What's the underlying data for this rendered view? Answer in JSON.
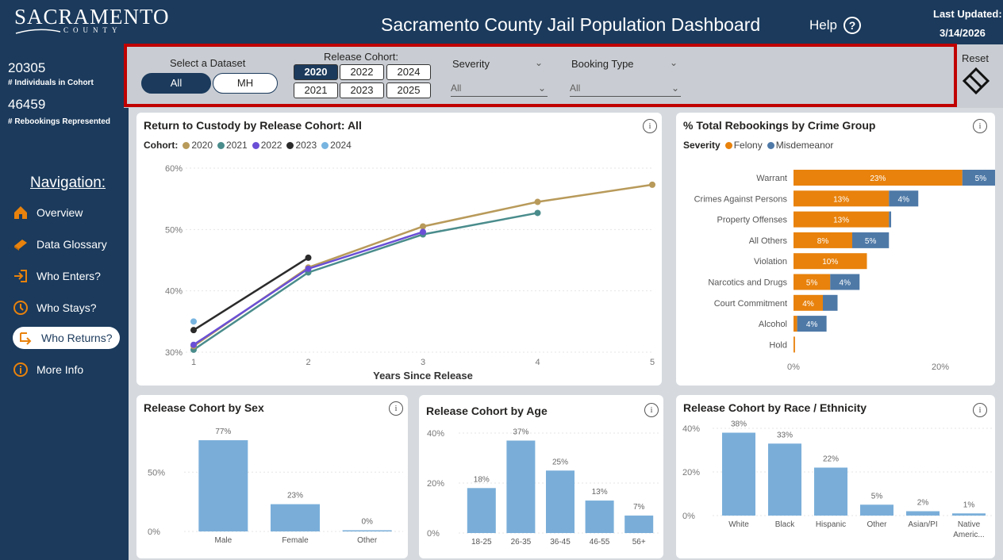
{
  "header": {
    "logo_text": "SACRAMENTO",
    "logo_sub": "COUNTY",
    "title": "Sacramento County Jail Population Dashboard",
    "help_label": "Help",
    "help_icon": "question-circle-icon",
    "updated_label": "Last Updated:",
    "updated_date": "3/14/2026"
  },
  "sidebar": {
    "individuals_value": "20305",
    "individuals_label": "# Individuals in Cohort",
    "rebookings_value": "46459",
    "rebookings_label": "# Rebookings Represented",
    "nav_title": "Navigation:",
    "items": [
      {
        "label": "Overview",
        "icon": "home-icon"
      },
      {
        "label": "Data Glossary",
        "icon": "book-icon"
      },
      {
        "label": "Who Enters?",
        "icon": "enter-icon"
      },
      {
        "label": "Who Stays?",
        "icon": "clock-icon"
      },
      {
        "label": "Who Returns?",
        "icon": "return-arrow-icon",
        "active": true
      },
      {
        "label": "More Info",
        "icon": "info-icon"
      }
    ]
  },
  "filters": {
    "dataset_label": "Select a Dataset",
    "dataset_options": [
      "All",
      "MH"
    ],
    "dataset_selected": "All",
    "cohort_label": "Release Cohort:",
    "cohort_options": [
      "2020",
      "2022",
      "2024",
      "2021",
      "2023",
      "2025"
    ],
    "cohort_selected": "2020",
    "severity_label": "Severity",
    "severity_value": "All",
    "booking_label": "Booking Type",
    "booking_value": "All",
    "reset_label": "Reset"
  },
  "colors": {
    "navy": "#1b3a5c",
    "felony": "#e8820c",
    "misdemeanor": "#4e79a7",
    "bar": "#7aaed9",
    "c2020": "#b89a5a",
    "c2021": "#4a8c8c",
    "c2022": "#6a4fd6",
    "c2023": "#2b2b2b",
    "c2024": "#78b4e0",
    "highlight": "#c00000"
  },
  "charts": {
    "rtc": {
      "title": "Return to Custody by Release Cohort: All",
      "legend_title": "Cohort:",
      "xlabel": "Years Since Release"
    },
    "crime": {
      "title": "% Total Rebookings by Crime Group",
      "legend_title": "Severity"
    },
    "sex": {
      "title": "Release Cohort by Sex"
    },
    "age": {
      "title": "Release Cohort by Age"
    },
    "race": {
      "title": "Release Cohort by Race / Ethnicity"
    }
  },
  "chart_data": [
    {
      "type": "line",
      "title": "Return to Custody by Release Cohort: All",
      "xlabel": "Years Since Release",
      "x": [
        1,
        2,
        3,
        4,
        5
      ],
      "yticks": [
        "30%",
        "40%",
        "50%",
        "60%"
      ],
      "ylim": [
        0.3,
        0.6
      ],
      "series": [
        {
          "name": "2020",
          "x": [
            1,
            2,
            3,
            4,
            5
          ],
          "values": [
            0.31,
            0.438,
            0.505,
            0.545,
            0.573
          ]
        },
        {
          "name": "2021",
          "x": [
            1,
            2,
            3,
            4
          ],
          "values": [
            0.304,
            0.43,
            0.492,
            0.527
          ]
        },
        {
          "name": "2022",
          "x": [
            1,
            2,
            3
          ],
          "values": [
            0.312,
            0.436,
            0.496
          ]
        },
        {
          "name": "2023",
          "x": [
            1,
            2
          ],
          "values": [
            0.336,
            0.454
          ]
        },
        {
          "name": "2024",
          "x": [
            1
          ],
          "values": [
            0.35
          ]
        }
      ]
    },
    {
      "type": "bar",
      "orientation": "horizontal",
      "stacked": true,
      "title": "% Total Rebookings by Crime Group",
      "categories": [
        "Warrant",
        "Crimes Against Persons",
        "Property Offenses",
        "All Others",
        "Violation",
        "Narcotics and Drugs",
        "Court Commitment",
        "Alcohol",
        "Hold"
      ],
      "xticks": [
        "0%",
        "20%"
      ],
      "xlim": [
        0,
        0.27
      ],
      "series": [
        {
          "name": "Felony",
          "values": [
            0.23,
            0.13,
            0.13,
            0.08,
            0.1,
            0.05,
            0.04,
            0.005,
            0.002
          ],
          "labels": [
            "23%",
            "13%",
            "13%",
            "8%",
            "10%",
            "5%",
            "4%",
            "",
            ""
          ]
        },
        {
          "name": "Misdemeanor",
          "values": [
            0.05,
            0.04,
            0.003,
            0.05,
            0.0,
            0.04,
            0.02,
            0.04,
            0.0
          ],
          "labels": [
            "5%",
            "4%",
            "",
            "5%",
            "",
            "4%",
            "",
            "4%",
            ""
          ]
        }
      ]
    },
    {
      "type": "bar",
      "title": "Release Cohort by Sex",
      "categories": [
        "Male",
        "Female",
        "Other"
      ],
      "values": [
        0.77,
        0.23,
        0.003
      ],
      "labels": [
        "77%",
        "23%",
        "0%"
      ],
      "yticks": [
        "0%",
        "50%"
      ],
      "ylim": [
        0,
        0.83
      ]
    },
    {
      "type": "bar",
      "title": "Release Cohort by Age",
      "categories": [
        "18-25",
        "26-35",
        "36-45",
        "46-55",
        "56+"
      ],
      "values": [
        0.18,
        0.37,
        0.25,
        0.13,
        0.07
      ],
      "labels": [
        "18%",
        "37%",
        "25%",
        "13%",
        "7%"
      ],
      "yticks": [
        "0%",
        "20%",
        "40%"
      ],
      "ylim": [
        0,
        0.4
      ]
    },
    {
      "type": "bar",
      "title": "Release Cohort by Race / Ethnicity",
      "categories": [
        "White",
        "Black",
        "Hispanic",
        "Other",
        "Asian/PI",
        "Native Americ..."
      ],
      "values": [
        0.38,
        0.33,
        0.22,
        0.05,
        0.02,
        0.01
      ],
      "labels": [
        "38%",
        "33%",
        "22%",
        "5%",
        "2%",
        "1%"
      ],
      "yticks": [
        "0%",
        "20%",
        "40%"
      ],
      "ylim": [
        0,
        0.4
      ]
    }
  ]
}
